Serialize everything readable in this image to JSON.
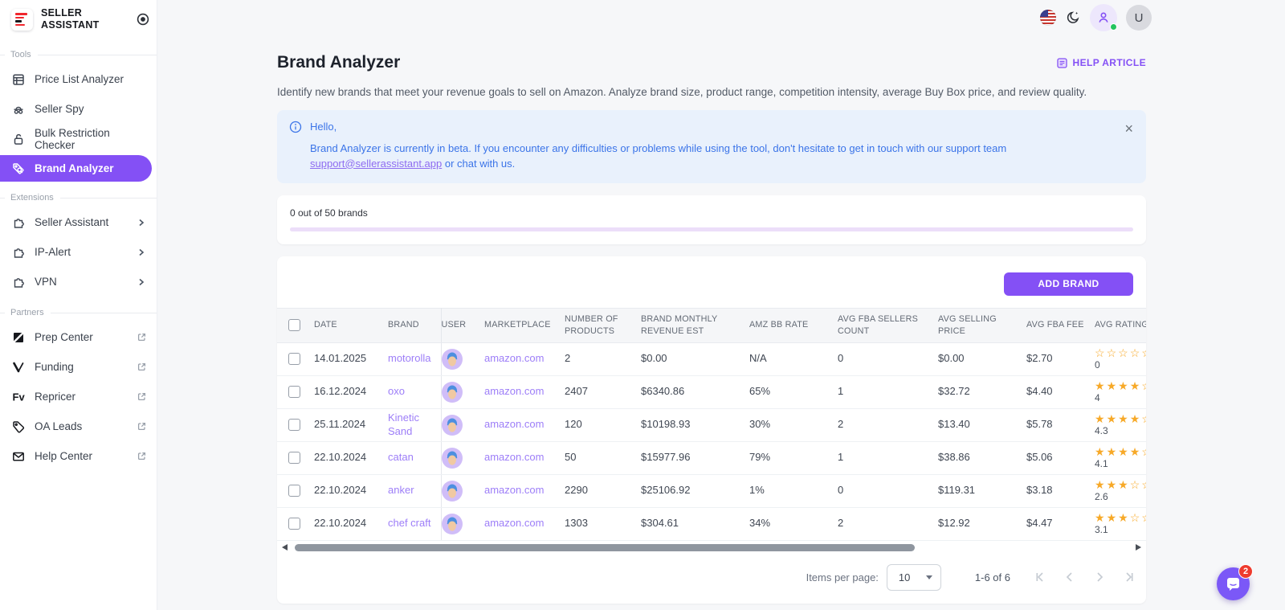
{
  "app": {
    "name_line1": "SELLER",
    "name_line2": "ASSISTANT"
  },
  "sidebar": {
    "sections": [
      {
        "label": "Tools",
        "items": [
          {
            "label": "Price List Analyzer"
          },
          {
            "label": "Seller Spy"
          },
          {
            "label": "Bulk Restriction Checker"
          },
          {
            "label": "Brand Analyzer",
            "active": true
          }
        ]
      },
      {
        "label": "Extensions",
        "items": [
          {
            "label": "Seller Assistant"
          },
          {
            "label": "IP-Alert"
          },
          {
            "label": "VPN"
          }
        ]
      },
      {
        "label": "Partners",
        "items": [
          {
            "label": "Prep Center"
          },
          {
            "label": "Funding"
          },
          {
            "label": "Repricer"
          },
          {
            "label": "OA Leads"
          },
          {
            "label": "Help Center"
          }
        ]
      }
    ]
  },
  "topbar": {
    "avatar_initial": "U"
  },
  "page": {
    "title": "Brand Analyzer",
    "help_link": "HELP ARTICLE",
    "description": "Identify new brands that meet your revenue goals to sell on Amazon. Analyze brand size, product range, competition intensity, average Buy Box price, and review quality."
  },
  "banner": {
    "greeting": "Hello,",
    "message_part1": "Brand Analyzer is currently in beta. If you encounter any difficulties or problems while using the tool, don't hesitate to get in touch with our support team",
    "link": "support@sellerassistant.app",
    "message_part2": " or chat with us.",
    "close": "×"
  },
  "progress": {
    "label": "0 out of 50 brands",
    "percent": 0
  },
  "table": {
    "add_button": "ADD BRAND",
    "columns": [
      "DATE",
      "BRAND",
      "USER",
      "MARKETPLACE",
      "NUMBER OF PRODUCTS",
      "BRAND MONTHLY REVENUE EST",
      "AMZ BB RATE",
      "AVG FBA SELLERS COUNT",
      "AVG SELLING PRICE",
      "AVG FBA FEE",
      "AVG RATING"
    ],
    "rows": [
      {
        "date": "14.01.2025",
        "brand": "motorolla",
        "marketplace": "amazon.com",
        "products": "2",
        "revenue": "$0.00",
        "bb_rate": "N/A",
        "fba_sellers": "0",
        "selling_price": "$0.00",
        "fba_fee": "$2.70",
        "rating": 0
      },
      {
        "date": "16.12.2024",
        "brand": "oxo",
        "marketplace": "amazon.com",
        "products": "2407",
        "revenue": "$6340.86",
        "bb_rate": "65%",
        "fba_sellers": "1",
        "selling_price": "$32.72",
        "fba_fee": "$4.40",
        "rating": 4
      },
      {
        "date": "25.11.2024",
        "brand": "Kinetic Sand",
        "marketplace": "amazon.com",
        "products": "120",
        "revenue": "$10198.93",
        "bb_rate": "30%",
        "fba_sellers": "2",
        "selling_price": "$13.40",
        "fba_fee": "$5.78",
        "rating": 4.3
      },
      {
        "date": "22.10.2024",
        "brand": "catan",
        "marketplace": "amazon.com",
        "products": "50",
        "revenue": "$15977.96",
        "bb_rate": "79%",
        "fba_sellers": "1",
        "selling_price": "$38.86",
        "fba_fee": "$5.06",
        "rating": 4.1
      },
      {
        "date": "22.10.2024",
        "brand": "anker",
        "marketplace": "amazon.com",
        "products": "2290",
        "revenue": "$25106.92",
        "bb_rate": "1%",
        "fba_sellers": "0",
        "selling_price": "$119.31",
        "fba_fee": "$3.18",
        "rating": 2.6
      },
      {
        "date": "22.10.2024",
        "brand": "chef craft",
        "marketplace": "amazon.com",
        "products": "1303",
        "revenue": "$304.61",
        "bb_rate": "34%",
        "fba_sellers": "2",
        "selling_price": "$12.92",
        "fba_fee": "$4.47",
        "rating": 3.1
      }
    ]
  },
  "pagination": {
    "items_per_page_label": "Items per page:",
    "items_per_page": "10",
    "range": "1-6 of 6"
  },
  "chat": {
    "badge": "2"
  },
  "colors": {
    "accent": "#8450f5",
    "link": "#9d7ef8",
    "banner_bg": "#e9f1fc",
    "banner_text": "#3b74e8",
    "star": "#f7a928",
    "badge": "#ee3b2e",
    "progress_track": "#ecdef9"
  }
}
